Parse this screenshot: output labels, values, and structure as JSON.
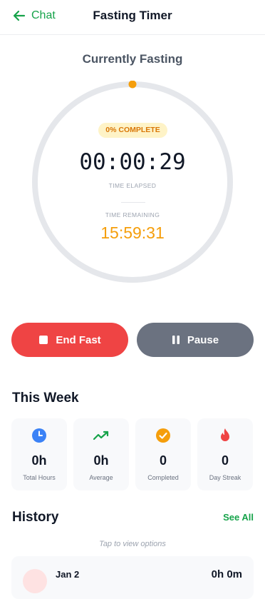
{
  "header": {
    "back_label": "Chat",
    "title": "Fasting Timer"
  },
  "timer": {
    "status": "Currently Fasting",
    "percent_label": "0% COMPLETE",
    "progress_fraction": 0.0,
    "elapsed": "00:00:29",
    "elapsed_label": "TIME ELAPSED",
    "remaining_label": "TIME REMAINING",
    "remaining": "15:59:31"
  },
  "actions": {
    "end_label": "End Fast",
    "pause_label": "Pause"
  },
  "week": {
    "title": "This Week",
    "stats": [
      {
        "value": "0h",
        "label": "Total Hours",
        "icon": "clock-icon",
        "color": "#3b82f6"
      },
      {
        "value": "0h",
        "label": "Average",
        "icon": "trend-icon",
        "color": "#16a34a"
      },
      {
        "value": "0",
        "label": "Completed",
        "icon": "check-circle-icon",
        "color": "#f59e0b"
      },
      {
        "value": "0",
        "label": "Day Streak",
        "icon": "flame-icon",
        "color": "#ef4444"
      }
    ]
  },
  "history": {
    "title": "History",
    "see_all": "See All",
    "hint": "Tap to view options",
    "items": [
      {
        "date": "Jan 2",
        "duration": "0h 0m"
      }
    ]
  },
  "colors": {
    "accent": "#16a34a",
    "progress": "#f59e0b",
    "end_button": "#ef4444",
    "pause_button": "#6b7280"
  }
}
